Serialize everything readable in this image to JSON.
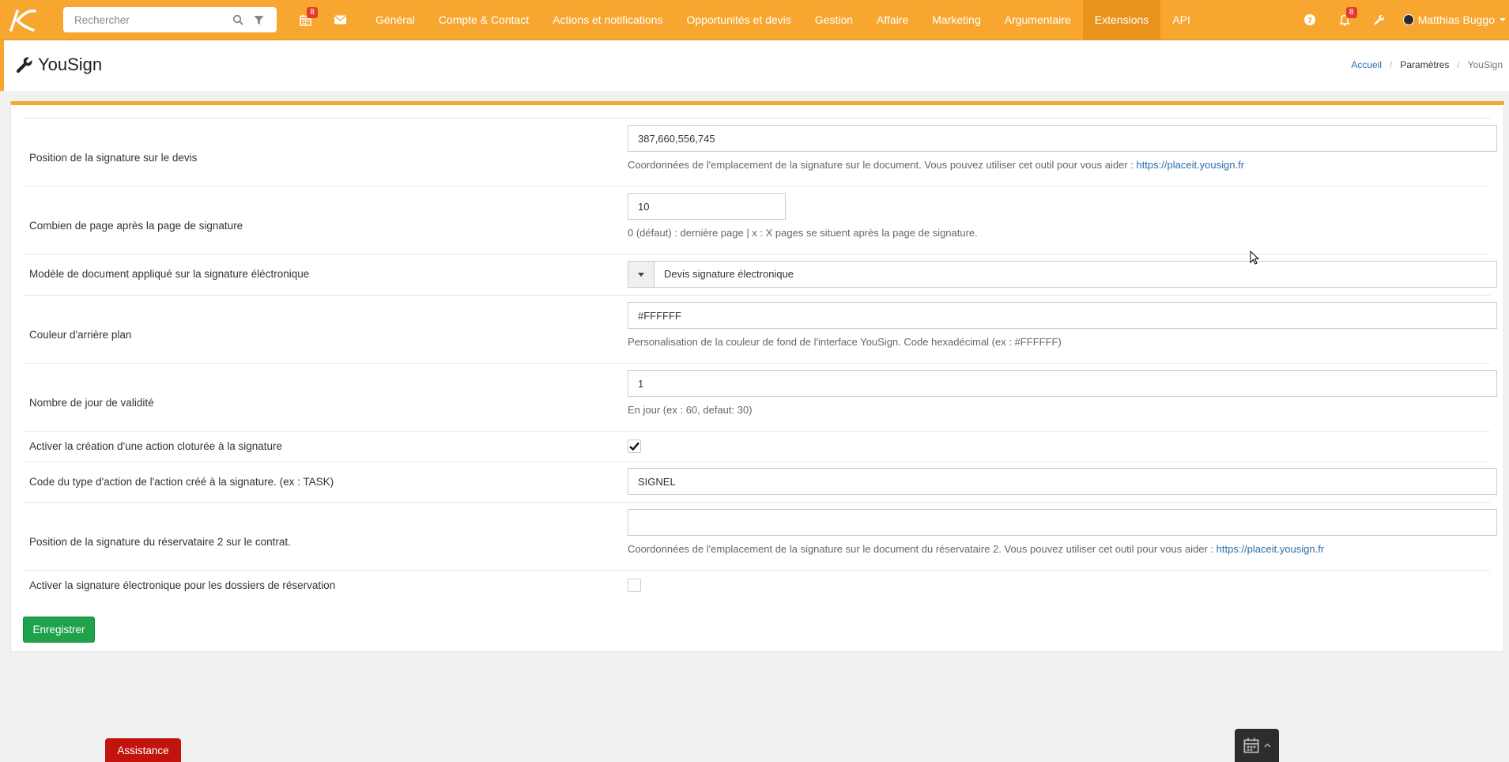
{
  "topbar": {
    "search_placeholder": "Rechercher",
    "calendar_badge": "8",
    "notifications_badge": "8",
    "nav": [
      "Général",
      "Compte & Contact",
      "Actions et notifications",
      "Opportunités et devis",
      "Gestion",
      "Affaire",
      "Marketing",
      "Argumentaire",
      "Extensions",
      "API"
    ],
    "active_nav": "Extensions",
    "user_name": "Matthias Buggo"
  },
  "header": {
    "title": "YouSign",
    "breadcrumb": [
      "Accueil",
      "Paramètres",
      "YouSign"
    ]
  },
  "form": {
    "rows": [
      {
        "label": "Position de la signature sur le devis",
        "value": "387,660,556,745",
        "help": "Coordonnées de l'emplacement de la signature sur le document. Vous pouvez utiliser cet outil pour vous aider : ",
        "link": "https://placeit.yousign.fr"
      },
      {
        "label": "Combien de page après la page de signature",
        "value": "10",
        "help": "0 (défaut) : dernière page | x : X pages se situent après la page de signature."
      },
      {
        "label": "Modèle de document appliqué sur la signature éléctronique",
        "value": "Devis signature électronique"
      },
      {
        "label": "Couleur d'arrière plan",
        "value": "#FFFFFF",
        "help": "Personalisation de la couleur de fond de l'interface YouSign. Code hexadécimal (ex : #FFFFFF)"
      },
      {
        "label": "Nombre de jour de validité",
        "value": "1",
        "help": "En jour (ex : 60, defaut: 30)"
      },
      {
        "label": "Activer la création d'une action cloturée à la signature",
        "checked": true
      },
      {
        "label": "Code du type d'action de l'action créé à la signature. (ex : TASK)",
        "value": "SIGNEL"
      },
      {
        "label": "Position de la signature du réservataire 2 sur le contrat.",
        "value": "",
        "help": "Coordonnées de l'emplacement de la signature sur le document du réservataire 2. Vous pouvez utiliser cet outil pour vous aider : ",
        "link": "https://placeit.yousign.fr"
      },
      {
        "label": "Activer la signature électronique pour les dossiers de réservation",
        "checked": false
      }
    ],
    "save_label": "Enregistrer"
  },
  "footer": {
    "assistance_label": "Assistance"
  },
  "colors": {
    "brand": "#f7a730",
    "active_nav": "#e8941c",
    "save": "#1fa34a",
    "assistance": "#c0140c",
    "link": "#2a6fab"
  }
}
